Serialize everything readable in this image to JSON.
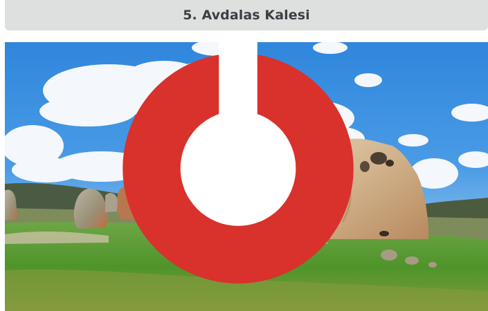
{
  "header": {
    "title": "5. Avdalas Kalesi"
  },
  "photo": {
    "subject": "Avdalas Kalesi rock formations",
    "watermark_icon": "logo-icon",
    "colors": {
      "sky": "#3c8ee0",
      "grass": "#5a9a2e",
      "rock": "#c9b69a",
      "watermark": "#d9312b"
    }
  }
}
